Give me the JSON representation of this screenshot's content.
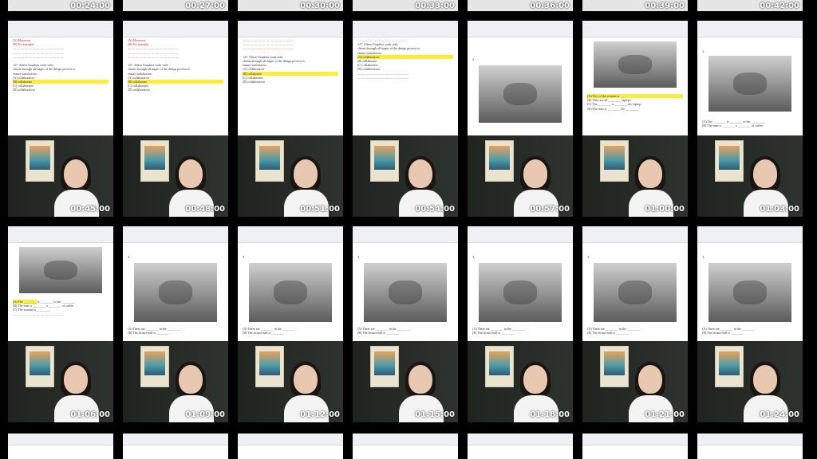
{
  "top_row_times": [
    "00:24:00",
    "00:27:00",
    "00:30:00",
    "00:33:00",
    "00:36:00",
    "00:39:00",
    "00:42:00"
  ],
  "row1": [
    {
      "time": "00:45:00",
      "doc": "text"
    },
    {
      "time": "00:48:00",
      "doc": "text"
    },
    {
      "time": "00:51:00",
      "doc": "text"
    },
    {
      "time": "00:54:00",
      "doc": "text"
    },
    {
      "time": "00:57:00",
      "doc": "photo",
      "label": "2."
    },
    {
      "time": "01:00:00",
      "doc": "photo"
    },
    {
      "time": "01:03:00",
      "doc": "photo",
      "label": "3."
    }
  ],
  "row2": [
    {
      "time": "01:06:00",
      "doc": "photo"
    },
    {
      "time": "01:09:00",
      "doc": "photo",
      "label": "3."
    },
    {
      "time": "01:12:00",
      "doc": "photo",
      "label": "3."
    },
    {
      "time": "01:15:00",
      "doc": "photo",
      "label": "3."
    },
    {
      "time": "01:18:00",
      "doc": "photo",
      "label": "3."
    },
    {
      "time": "01:21:00",
      "doc": "photo",
      "label": "3."
    },
    {
      "time": "01:24:00",
      "doc": "photo",
      "label": "3."
    }
  ],
  "doc_snippets": {
    "q127": "127. Altera Graphics work with",
    "clients": "clients through all stages of the design process to",
    "ensure": "ensure satisfaction.",
    "a": "(A) collaborative",
    "b": "(B) collaborate",
    "c": "(C) collaborates",
    "d": "(D) collaboration",
    "moreover": "(A) Moreover",
    "for_example": "(B) For example",
    "photo_a": "(A) There are ________ in the ________.",
    "photo_b": "(B) The lecture hall is ________.",
    "photo2_a": "(A) Two of the women is",
    "photo2_b": "(B) They are all ________ laptops.",
    "photo3_a": "(A) The ________ is ________ to her ________.",
    "photo3_b": "(B) The man is ________ a ________ of coffee."
  }
}
